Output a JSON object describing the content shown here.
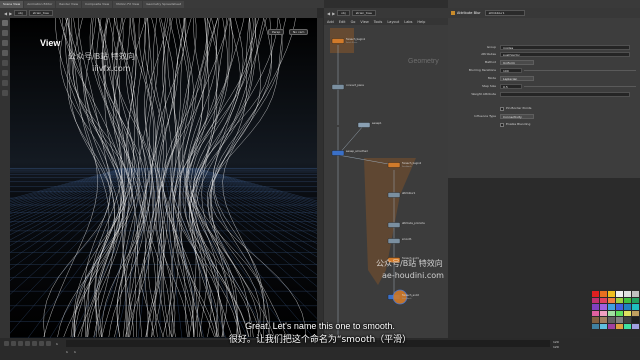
{
  "viewport_tabs": [
    "Scene View",
    "Animation Editor",
    "Render View",
    "Composite View",
    "Motion FX View",
    "Geometry Spreadsheet"
  ],
  "network_tabs": [
    "/obj/tree_build",
    "Tree View",
    "Material Palette"
  ],
  "path": {
    "obj": "obj",
    "node": "strain_tree"
  },
  "viewport": {
    "title": "View",
    "persp_label": "Persp",
    "cam_label": "No cam"
  },
  "network": {
    "path": {
      "obj": "obj",
      "node": "strain_tree"
    },
    "menu": [
      "Add",
      "Edit",
      "Go",
      "View",
      "Tools",
      "Layout",
      "Labs",
      "Help"
    ],
    "context_label": "Geometry",
    "nodes": [
      {
        "label": "foreach_begin1",
        "sub": "Fetch Piece",
        "color": "#d07a2a"
      },
      {
        "label": "connect_piece",
        "sub": "",
        "color": "#7a8fa0"
      },
      {
        "label": "sweep1",
        "sub": "",
        "color": "#8aa0b3"
      },
      {
        "label": "sweep_smoothed",
        "sub": "",
        "color": "#3a70c8"
      },
      {
        "label": "foreach_begin2",
        "sub": "Feedback",
        "color": "#d07a2a"
      },
      {
        "label": "attribblur1",
        "sub": "",
        "color": "#7a8fa0"
      },
      {
        "label": "attribute_promote",
        "sub": "",
        "color": "#7a8fa0"
      },
      {
        "label": "smooth",
        "sub": "",
        "color": "#7a8fa0"
      },
      {
        "label": "foreach_end1",
        "sub": "",
        "color": "#d07a2a"
      },
      {
        "label": "foreach_end2",
        "sub": "Feedback",
        "color": "#3a70c8"
      }
    ]
  },
  "params": {
    "node_type": "Attribute Blur",
    "node_name": "attribblur1",
    "group_label": "Group",
    "group_value": "rogdes",
    "attributes_label": "Attributes",
    "attributes_value": "pushVector",
    "method_label": "Method",
    "method_value": "Uniform",
    "iterations_label": "Blurring Iterations",
    "iterations_value": "100",
    "mode_label": "Mode",
    "mode_value": "Laplacian",
    "step_label": "Step Size",
    "step_value": "0.5",
    "weight_label": "Weight Attribute",
    "pin_border_label": "Pin Border Points",
    "influence_label": "Influence Type",
    "influence_value": "Connectivity",
    "enable_blending_label": "Enable Blending"
  },
  "timeline": {
    "frame": "1",
    "start": "1",
    "end": "1",
    "range_end": "120",
    "range_end2": "120"
  },
  "watermarks": {
    "top_cn": "公众号/B站 特效向",
    "top_url": "iiivfx.com",
    "mid_cn": "公众号/B站 特效向",
    "mid_url": "ae-houdini.com"
  },
  "subtitles": {
    "en": "Great. Let's name this one to smooth.",
    "cn": "很好。让我们把这个命名为“smooth（平滑）"
  },
  "palette_colors": [
    "#e02020",
    "#e87020",
    "#f0c020",
    "#f0f0f0",
    "#e0e0e0",
    "#c0c0c0",
    "#c03070",
    "#e04060",
    "#f08040",
    "#a0d040",
    "#40c040",
    "#20a060",
    "#8040c0",
    "#a060e0",
    "#40a0e0",
    "#4060e0",
    "#2080c0",
    "#20c0c0",
    "#e060a0",
    "#f0a0c0",
    "#a0e0a0",
    "#60e060",
    "#e0e060",
    "#c0a060",
    "#806040",
    "#a08060",
    "#606060",
    "#808080",
    "#404040",
    "#202020",
    "#4080a0",
    "#60c0e0",
    "#a040a0",
    "#e0a040",
    "#40e0a0",
    "#a0a0e0"
  ]
}
